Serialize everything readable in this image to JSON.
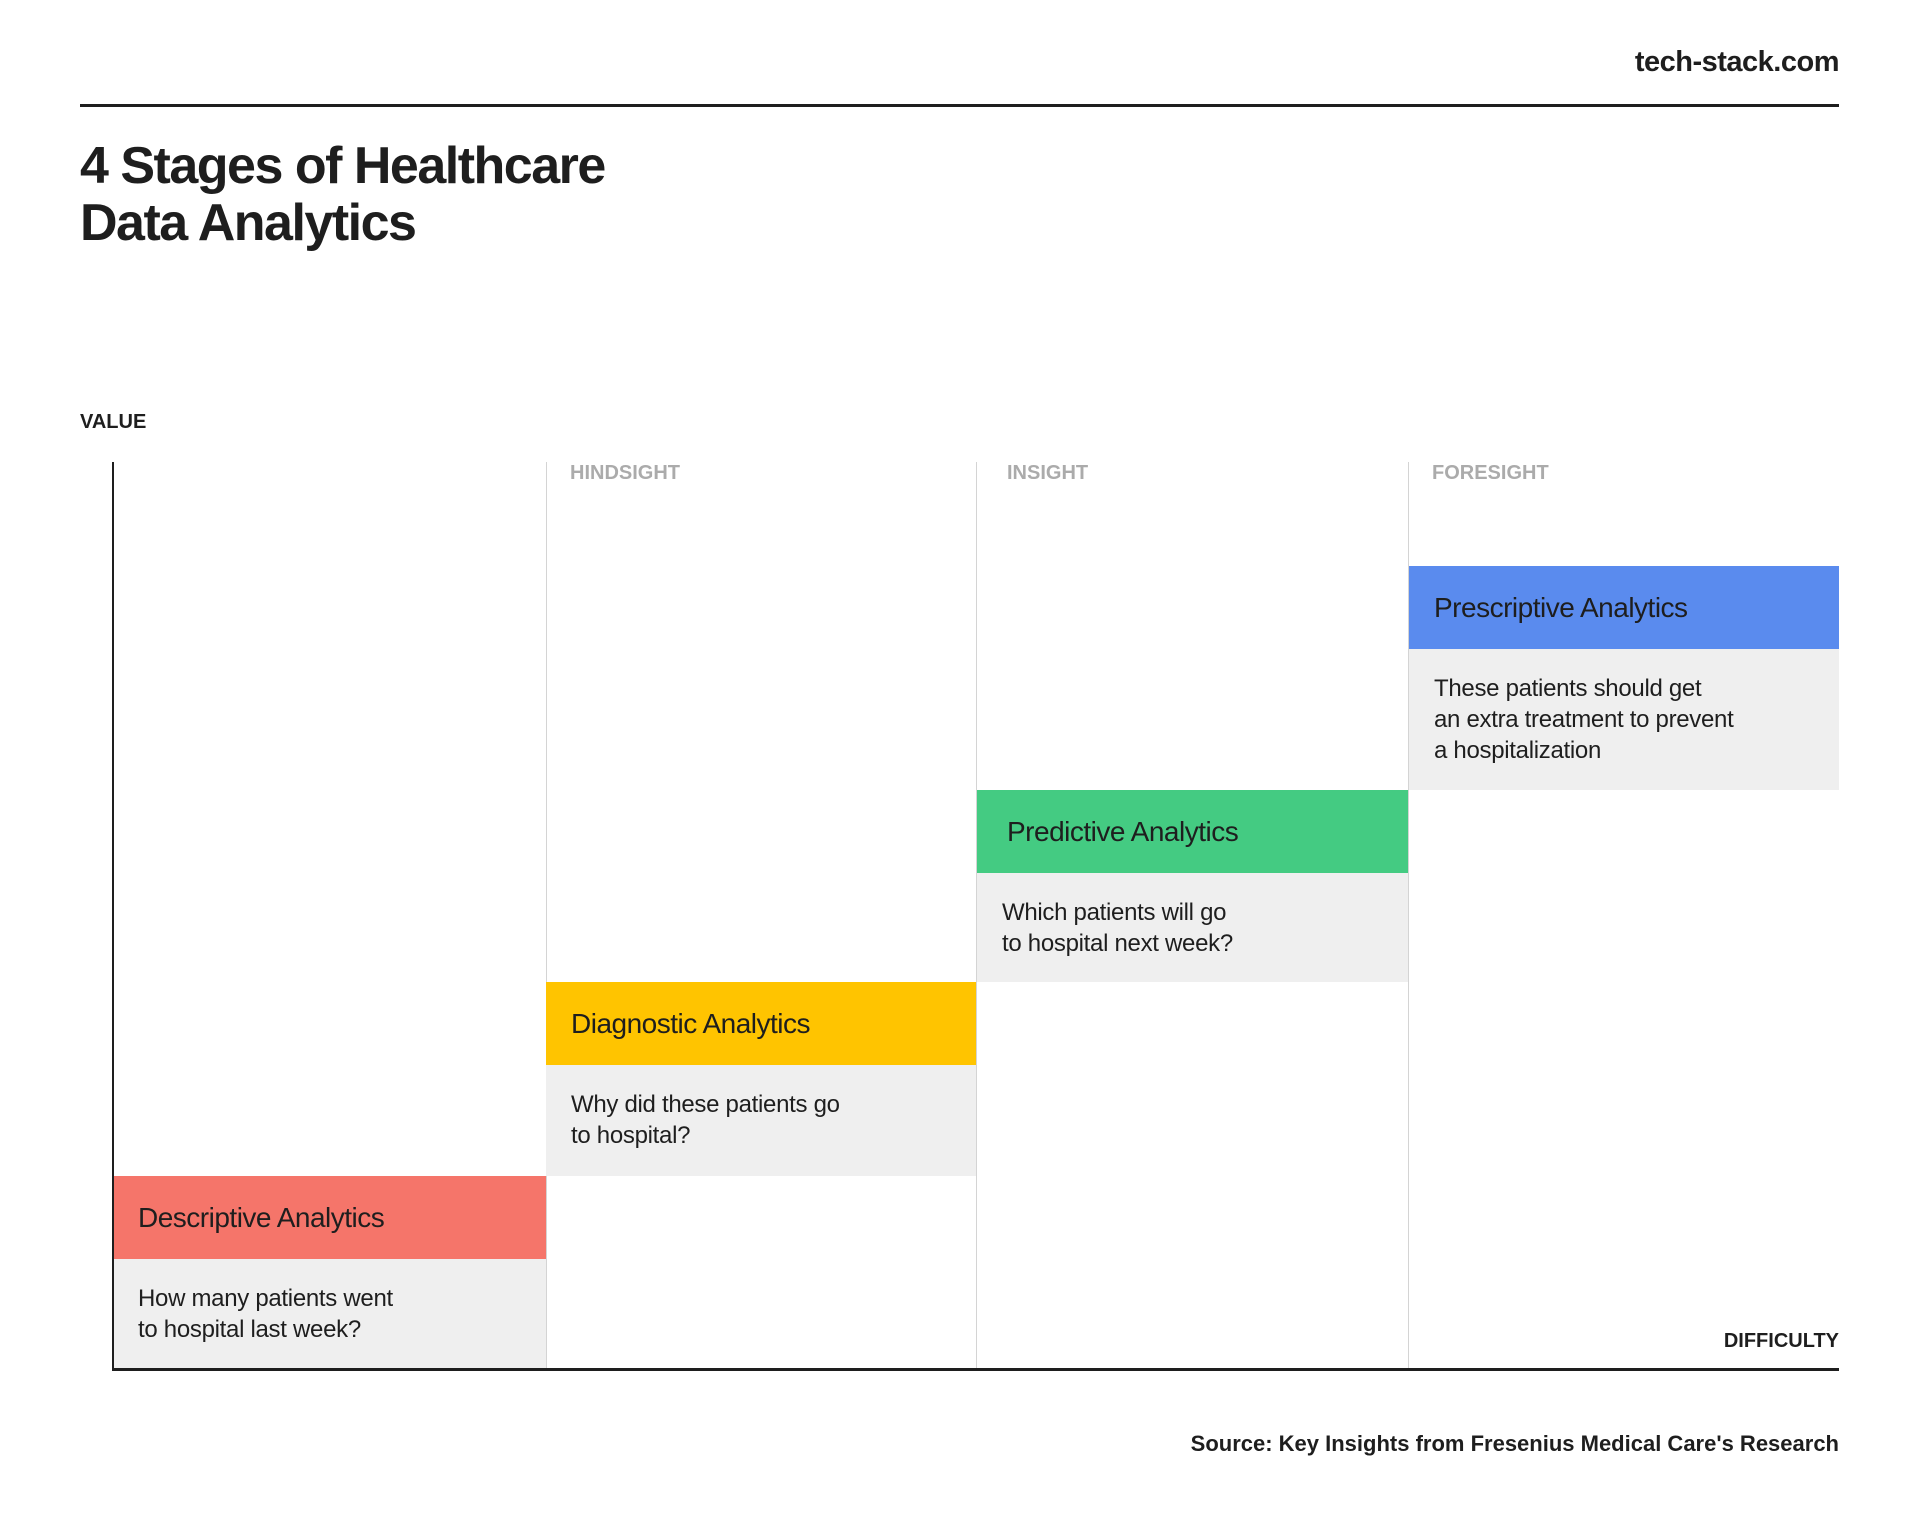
{
  "header": {
    "site": "tech-stack.com"
  },
  "title": {
    "line1": "4 Stages of Healthcare",
    "line2": "Data Analytics"
  },
  "axes": {
    "y_label": "VALUE",
    "x_label": "DIFFICULTY"
  },
  "columns": [
    "HINDSIGHT",
    "INSIGHT",
    "FORESIGHT"
  ],
  "stages": [
    {
      "name": "Descriptive Analytics",
      "question": "How many patients went\nto hospital last week?",
      "color": "#F5756A"
    },
    {
      "name": "Diagnostic Analytics",
      "question": "Why did these patients go\nto hospital?",
      "color": "#FFC400"
    },
    {
      "name": "Predictive Analytics",
      "question": "Which patients will go\nto hospital next week?",
      "color": "#44CB82"
    },
    {
      "name": "Prescriptive Analytics",
      "question": "These patients should get\nan extra treatment to prevent\na hospitalization",
      "color": "#5A8BEE"
    }
  ],
  "footer": {
    "source": "Source: Key Insights from Fresenius Medical Care's Research"
  }
}
